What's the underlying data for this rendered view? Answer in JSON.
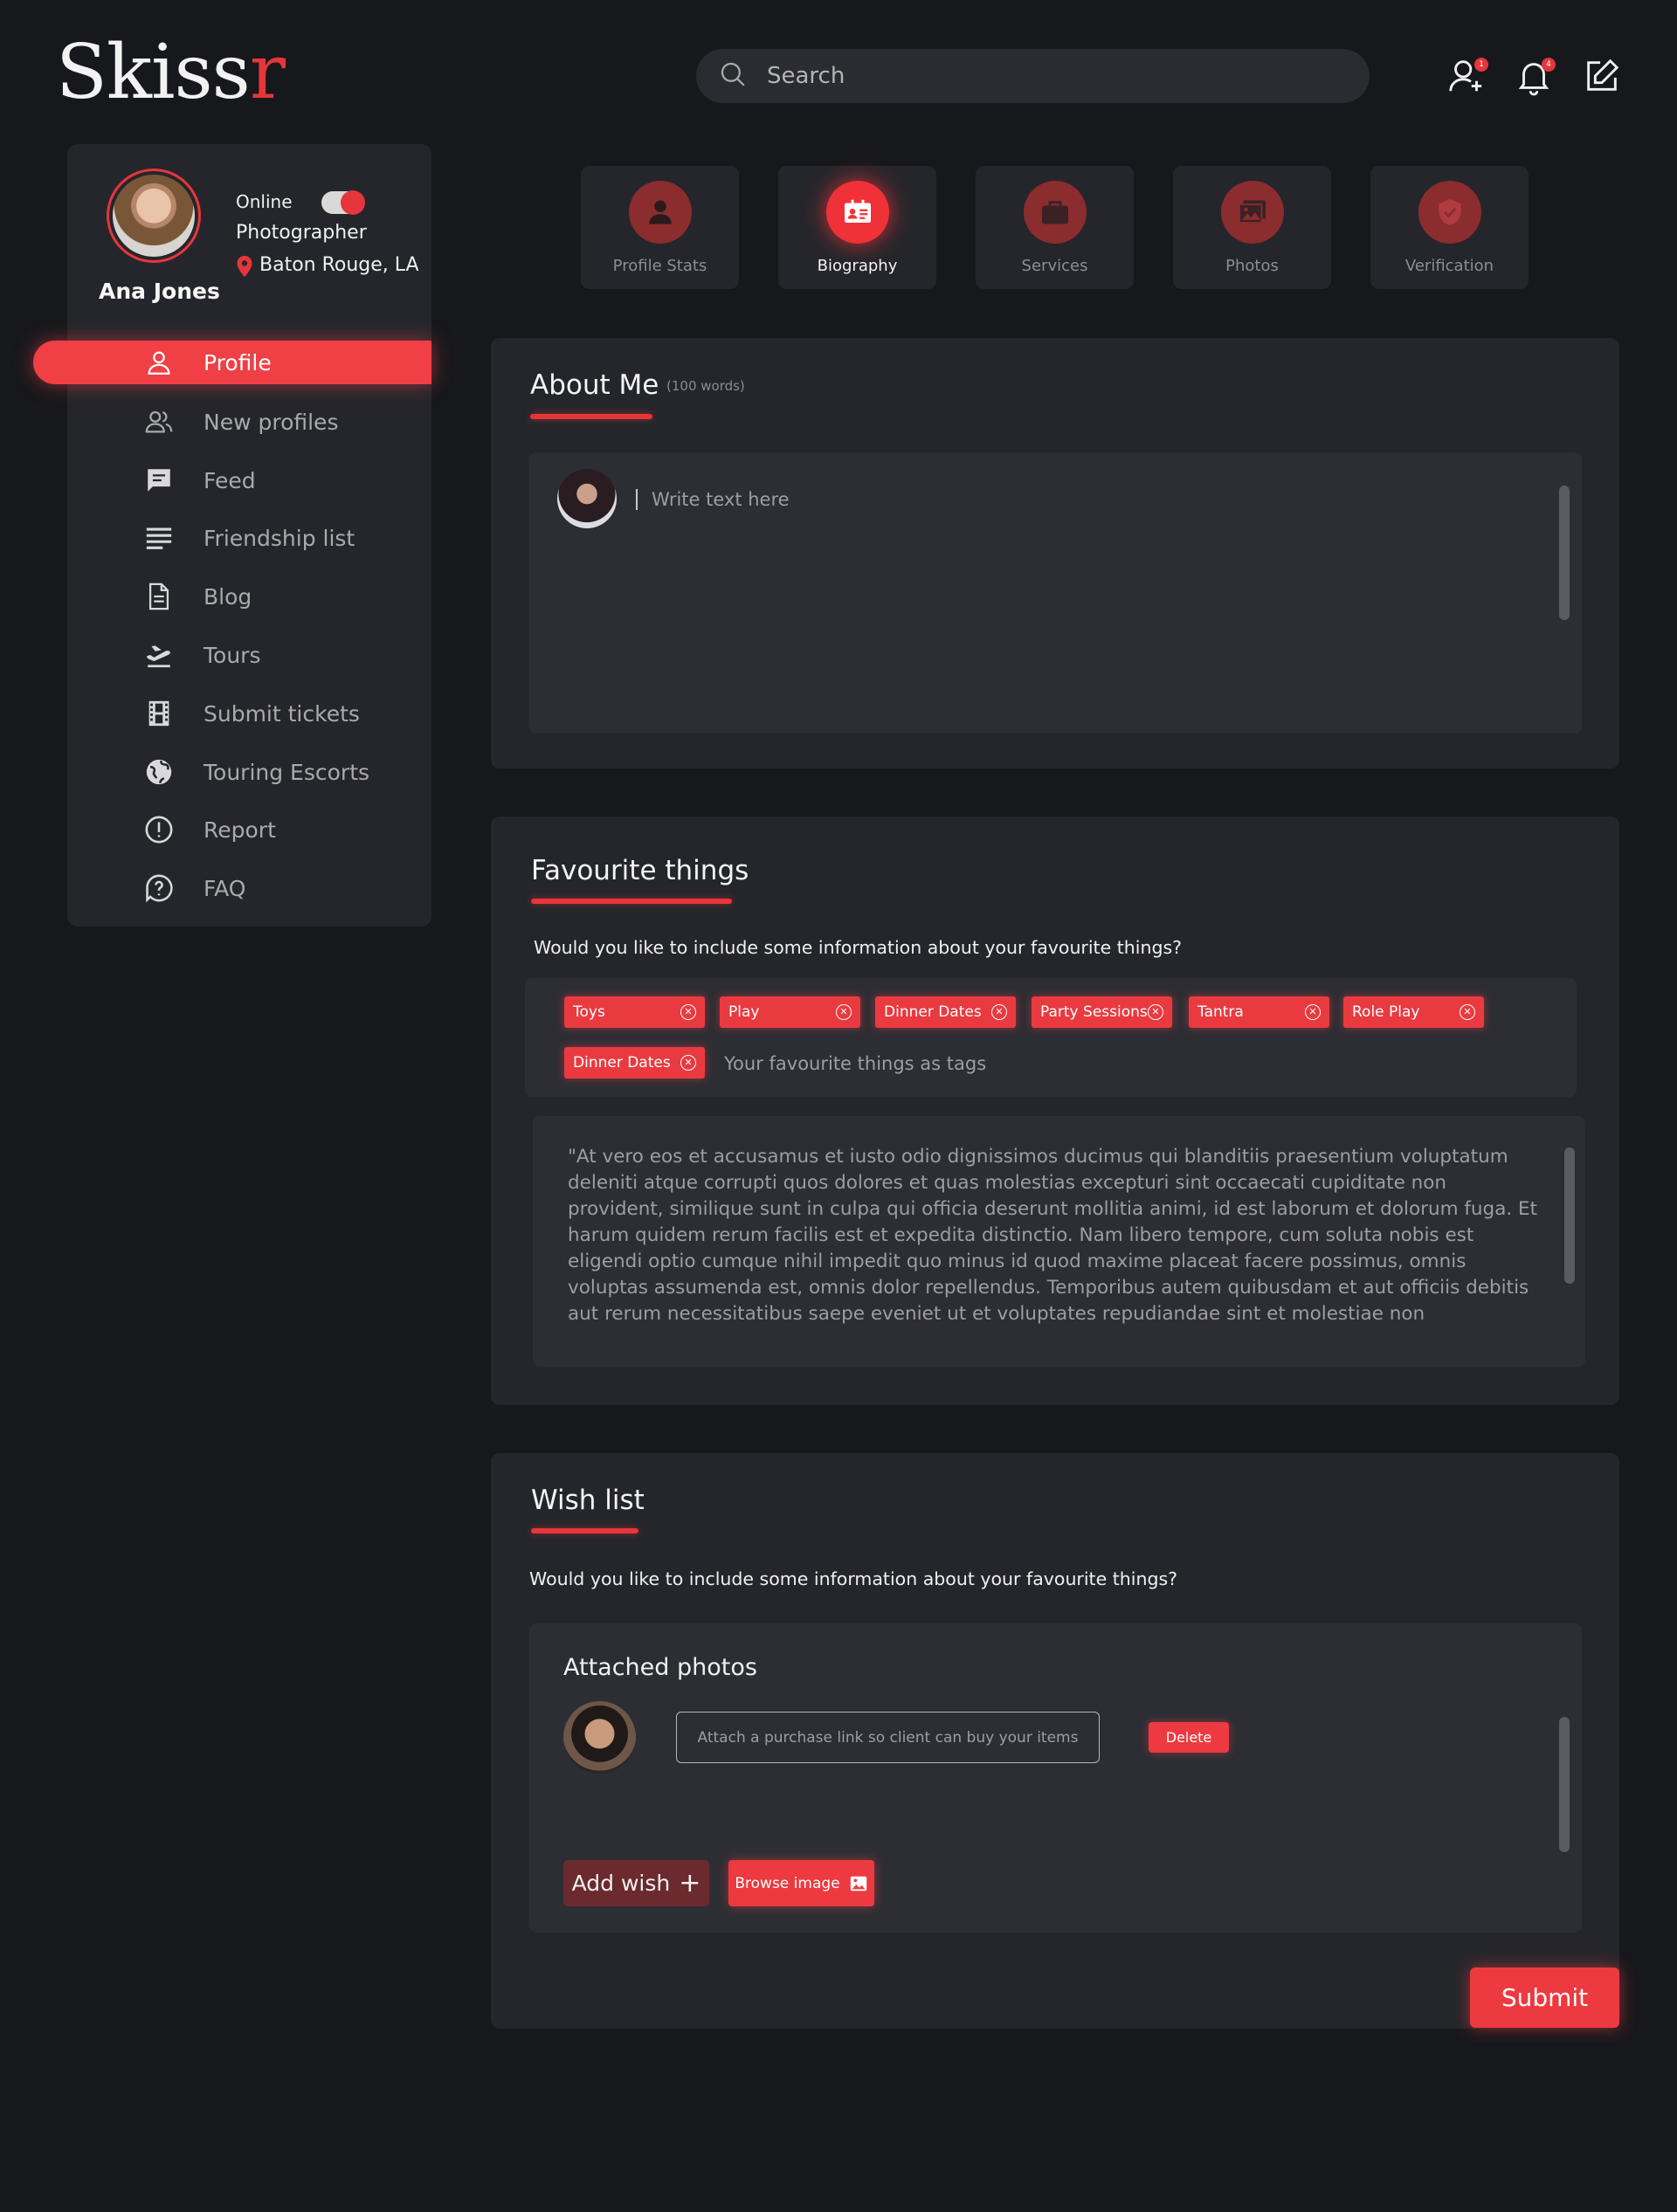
{
  "header": {
    "logo_main": "Skiss",
    "logo_accent": "r",
    "search_placeholder": "Search",
    "friend_badge": "1",
    "notif_badge": "4"
  },
  "profile": {
    "status": "Online",
    "role": "Photographer",
    "location": "Baton Rouge, LA",
    "name": "Ana Jones",
    "online": true
  },
  "sidebar": {
    "items": [
      {
        "label": "Profile",
        "icon": "user-icon",
        "active": true
      },
      {
        "label": "New profiles",
        "icon": "users-icon"
      },
      {
        "label": "Feed",
        "icon": "chat-icon"
      },
      {
        "label": "Friendship list",
        "icon": "list-icon"
      },
      {
        "label": "Blog",
        "icon": "document-icon"
      },
      {
        "label": "Tours",
        "icon": "plane-icon"
      },
      {
        "label": "Submit tickets",
        "icon": "film-icon"
      },
      {
        "label": "Touring Escorts",
        "icon": "globe-icon"
      },
      {
        "label": "Report",
        "icon": "alert-icon"
      },
      {
        "label": "FAQ",
        "icon": "question-icon"
      }
    ]
  },
  "tabs": [
    {
      "label": "Profile Stats",
      "icon": "person-icon"
    },
    {
      "label": "Biography",
      "icon": "id-card-icon",
      "active": true
    },
    {
      "label": "Services",
      "icon": "briefcase-icon"
    },
    {
      "label": "Photos",
      "icon": "images-icon"
    },
    {
      "label": "Verification",
      "icon": "shield-check-icon"
    }
  ],
  "about": {
    "title": "About Me",
    "hint": "(100 words)",
    "placeholder": "Write text here"
  },
  "favourites": {
    "title": "Favourite things",
    "prompt": "Would you like to include some information about your favourite things?",
    "tags": [
      "Toys",
      "Play",
      "Dinner Dates",
      "Party Sessions",
      "Tantra",
      "Role Play",
      "Dinner Dates"
    ],
    "tag_placeholder": "Your favourite things as tags",
    "text": "\"At vero eos et accusamus et iusto odio dignissimos ducimus qui blanditiis praesentium voluptatum deleniti atque corrupti quos dolores et quas molestias excepturi sint occaecati cupiditate non provident, similique sunt in culpa qui officia deserunt mollitia animi, id est laborum et dolorum fuga. Et harum quidem rerum facilis est et expedita distinctio. Nam libero tempore, cum soluta nobis est eligendi optio cumque nihil impedit quo minus id quod maxime placeat facere possimus, omnis voluptas assumenda est, omnis dolor repellendus. Temporibus autem quibusdam et aut officiis debitis aut rerum necessitatibus saepe eveniet ut et voluptates repudiandae sint et molestiae non recusandae. Itaque earum rerum hic tenetur a sapiente delectus, ut aut reiciendis voluptatibus"
  },
  "wishlist": {
    "title": "Wish list",
    "prompt": "Would you like to include some information about your favourite things?",
    "attached_title": "Attached photos",
    "link_placeholder": "Attach a purchase link so client can buy your items",
    "delete_label": "Delete",
    "add_label": "Add wish",
    "add_symbol": "+",
    "browse_label": "Browse image",
    "submit_label": "Submit"
  },
  "colors": {
    "accent": "#e5363b",
    "background": "#17181c",
    "panel": "#25262b",
    "inner": "#2d2e34"
  }
}
